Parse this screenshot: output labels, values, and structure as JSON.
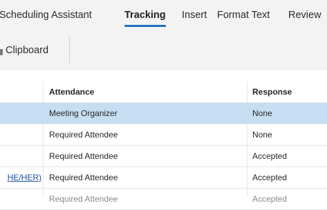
{
  "ribbon_tabs": [
    {
      "label": "Scheduling Assistant",
      "active": false
    },
    {
      "label": "Tracking",
      "active": true
    },
    {
      "label": "Insert",
      "active": false
    },
    {
      "label": "Format Text",
      "active": false
    },
    {
      "label": "Review",
      "active": false
    }
  ],
  "ribbon_group": {
    "label": "Clipboard"
  },
  "table": {
    "headers": {
      "attendance": "Attendance",
      "response": "Response"
    },
    "rows": [
      {
        "name": "",
        "attendance": "Meeting Organizer",
        "response": "None",
        "selected": true
      },
      {
        "name": "",
        "attendance": "Required Attendee",
        "response": "None",
        "selected": false
      },
      {
        "name": "",
        "attendance": "Required Attendee",
        "response": "Accepted",
        "selected": false
      },
      {
        "name": "HE/HER)",
        "attendance": "Required Attendee",
        "response": "Accepted",
        "selected": false
      },
      {
        "name": "",
        "attendance": "Required Attendee",
        "response": "Accepted",
        "selected": false
      }
    ]
  },
  "colors": {
    "accent": "#1f6fbf",
    "selected_row": "#c7ddf2",
    "link": "#1f4fa0"
  }
}
